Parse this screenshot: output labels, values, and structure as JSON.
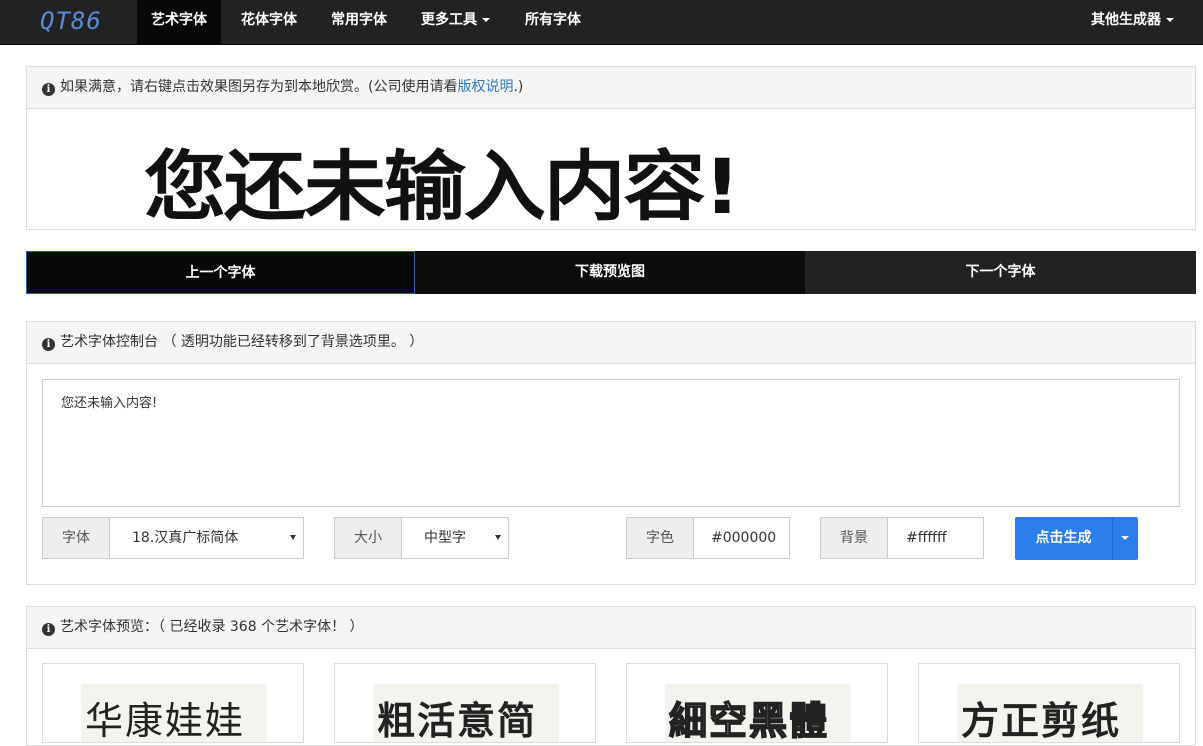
{
  "nav": {
    "brand": "QT86",
    "items": [
      {
        "label": "艺术字体",
        "active": true
      },
      {
        "label": "花体字体"
      },
      {
        "label": "常用字体"
      },
      {
        "label": "更多工具",
        "dropdown": true
      },
      {
        "label": "所有字体"
      }
    ],
    "right": "其他生成器"
  },
  "notice": {
    "text": "如果满意，请右键点击效果图另存为到本地欣赏。(公司使用请看",
    "link": "版权说明",
    "tail": ".)"
  },
  "preview": {
    "text": "您还未输入内容!"
  },
  "actions": {
    "prev": "上一个字体",
    "download": "下载预览图",
    "next": "下一个字体"
  },
  "console": {
    "heading": "艺术字体控制台 （ 透明功能已经转移到了背景选项里。 ）",
    "input_value": "您还未输入内容!",
    "font_label": "字体",
    "font_value": "18.汉真广标简体",
    "size_label": "大小",
    "size_value": "中型字",
    "color_label": "字色",
    "color_value": "#000000",
    "bg_label": "背景",
    "bg_value": "#ffffff",
    "generate": "点击生成"
  },
  "gallery": {
    "heading": "艺术字体预览：（ 已经收录 368 个艺术字体！ ）",
    "cards": [
      {
        "text": "华康娃娃"
      },
      {
        "text": "粗活意简"
      },
      {
        "text": "細空黑體"
      },
      {
        "text": "方正剪纸"
      }
    ]
  },
  "colors": {
    "navbar": "#222222",
    "nav_active": "#080808",
    "brand": "#5a8ad8",
    "primary": "#2b7de9",
    "link": "#337ab7"
  }
}
